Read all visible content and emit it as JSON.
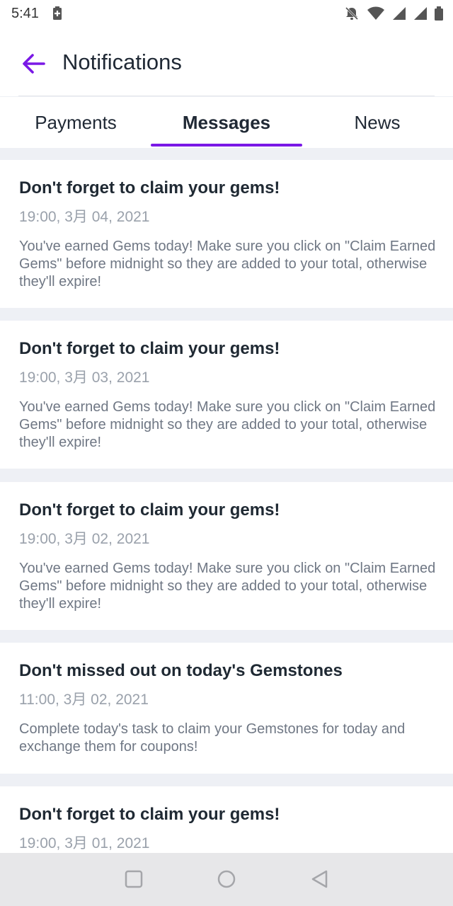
{
  "status": {
    "time": "5:41"
  },
  "header": {
    "title": "Notifications"
  },
  "tabs": [
    {
      "label": "Payments",
      "active": false
    },
    {
      "label": "Messages",
      "active": true
    },
    {
      "label": "News",
      "active": false
    }
  ],
  "messages": [
    {
      "title": "Don't forget to claim your gems!",
      "date": "19:00, 3月 04, 2021",
      "body": "You've earned Gems today! Make sure you click on \"Claim Earned Gems\" before midnight so they are added to your total, otherwise they'll expire!"
    },
    {
      "title": "Don't forget to claim your gems!",
      "date": "19:00, 3月 03, 2021",
      "body": "You've earned Gems today! Make sure you click on \"Claim Earned Gems\" before midnight so they are added to your total, otherwise they'll expire!"
    },
    {
      "title": "Don't forget to claim your gems!",
      "date": "19:00, 3月 02, 2021",
      "body": "You've earned Gems today! Make sure you click on \"Claim Earned Gems\" before midnight so they are added to your total, otherwise they'll expire!"
    },
    {
      "title": "Don't  missed out on today's Gemstones",
      "date": "11:00, 3月 02, 2021",
      "body": "Complete today's task to claim your Gemstones for today and exchange them for coupons!"
    },
    {
      "title": "Don't forget to claim your gems!",
      "date": "19:00, 3月 01, 2021",
      "body": ""
    }
  ],
  "colors": {
    "accent": "#7a18e6",
    "background": "#eef0f5"
  },
  "icons": {
    "back": "arrow-left-icon",
    "status_left": "battery-saver-icon",
    "status_right": [
      "mute-icon",
      "wifi-icon",
      "signal-icon",
      "signal-icon",
      "battery-icon"
    ],
    "nav": [
      "recent-apps-icon",
      "home-icon",
      "back-triangle-icon"
    ]
  }
}
